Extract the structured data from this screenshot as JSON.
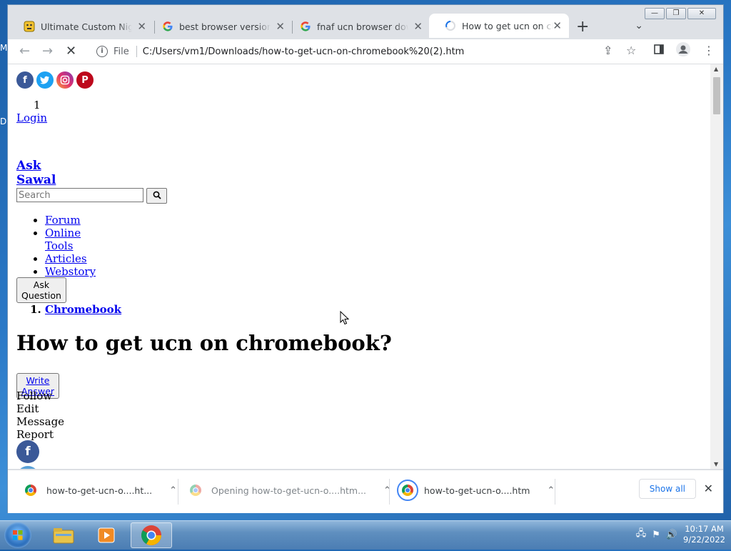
{
  "desktop": {
    "glyphs": [
      "M",
      "D"
    ]
  },
  "browser": {
    "tabs": [
      {
        "label": "Ultimate Custom Night |",
        "icon": "ucn-favicon",
        "close": "✕"
      },
      {
        "label": "best browser version of",
        "icon": "google-icon",
        "close": "✕"
      },
      {
        "label": "fnaf ucn browser downlo",
        "icon": "google-icon",
        "close": "✕"
      },
      {
        "label": "How to get ucn on chro",
        "icon": "loading-spinner-icon",
        "close": "✕"
      }
    ],
    "new_tab": "+",
    "address": {
      "scheme_label": "File",
      "url": "C:/Users/vm1/Downloads/how-to-get-ucn-on-chromebook%20(2).htm"
    }
  },
  "page": {
    "social_icons": [
      "facebook-icon",
      "twitter-icon",
      "instagram-icon",
      "pinterest-icon"
    ],
    "count": "1",
    "login": "Login",
    "brand": "Ask Sawal",
    "search_placeholder": "Search",
    "menu": [
      "Forum",
      "Online Tools",
      "Articles",
      "Webstory"
    ],
    "ask_button": "Ask Question",
    "breadcrumb": "Chromebook",
    "title": "How to get ucn on chromebook?",
    "write_answer": "Write Answer",
    "actions": [
      "Follow",
      "Edit",
      "Message",
      "Report"
    ]
  },
  "downloads": {
    "items": [
      {
        "name": "how-to-get-ucn-o....ht..."
      },
      {
        "name": "Opening how-to-get-ucn-o....htm..."
      },
      {
        "name": "how-to-get-ucn-o....htm"
      }
    ],
    "show_all": "Show all"
  },
  "taskbar": {
    "time": "10:17 AM",
    "date": "9/22/2022"
  }
}
